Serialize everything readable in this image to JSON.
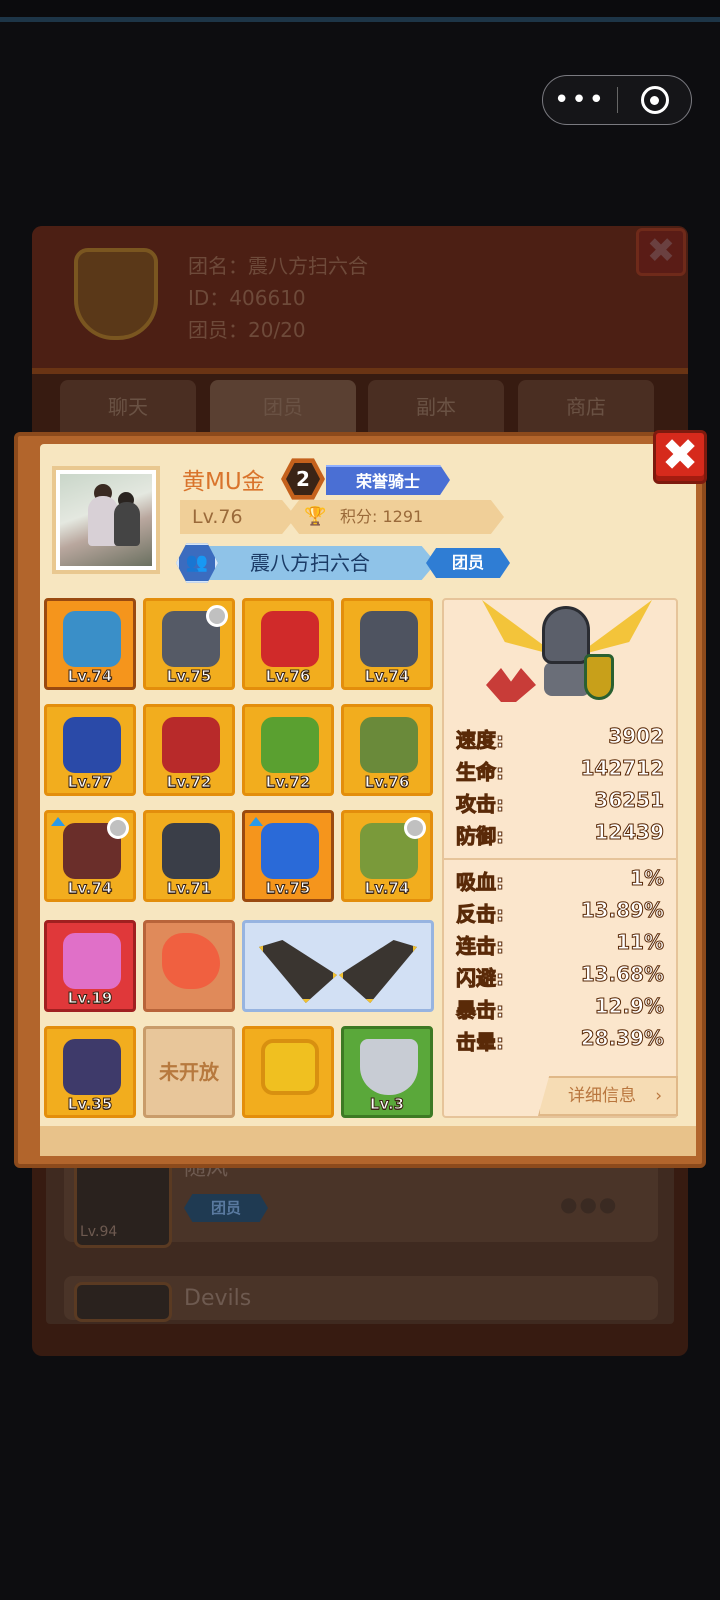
{
  "capsule": {
    "more_icon": "more-dots-icon",
    "target_icon": "target-icon"
  },
  "background": {
    "guild_name_line": "团名：震八方扫六合",
    "guild_id_line": "ID：406610",
    "members_line": "团员：20/20",
    "tabs": [
      "聊天",
      "团员",
      "副本",
      "商店"
    ],
    "member_rows": [
      {
        "name": "随风",
        "role": "团员",
        "level": "Lv.94"
      },
      {
        "name": "Devils"
      }
    ]
  },
  "player": {
    "name": "黄MU金",
    "rank_number": "2",
    "title": "荣誉骑士",
    "level": "Lv.76",
    "score_label": "积分: 1291",
    "guild_name": "震八方扫六合",
    "role": "团员"
  },
  "equipment": [
    {
      "level": "Lv.74",
      "icon": "helmet-icon",
      "style": "orange",
      "swirl": false,
      "up": false,
      "art": "#3a8fc8"
    },
    {
      "level": "Lv.75",
      "icon": "dark-helm-icon",
      "style": "gold",
      "swirl": true,
      "up": false,
      "art": "#555a66"
    },
    {
      "level": "Lv.76",
      "icon": "red-scarf-icon",
      "style": "gold",
      "swirl": false,
      "up": false,
      "art": "#d02a2a"
    },
    {
      "level": "Lv.74",
      "icon": "gauntlet-icon",
      "style": "gold",
      "swirl": false,
      "up": false,
      "art": "#4e5360"
    },
    {
      "level": "Lv.77",
      "icon": "blue-armor-icon",
      "style": "gold",
      "swirl": false,
      "up": false,
      "art": "#2a4aa8"
    },
    {
      "level": "Lv.72",
      "icon": "red-glove-icon",
      "style": "gold",
      "swirl": false,
      "up": false,
      "art": "#b82a2a"
    },
    {
      "level": "Lv.72",
      "icon": "green-belt-icon",
      "style": "gold",
      "swirl": false,
      "up": false,
      "art": "#5aa030"
    },
    {
      "level": "Lv.76",
      "icon": "green-vest-icon",
      "style": "gold",
      "swirl": false,
      "up": false,
      "art": "#6a8a3a"
    },
    {
      "level": "Lv.74",
      "icon": "spiked-mace-icon",
      "style": "gold",
      "swirl": true,
      "up": true,
      "art": "#6a2e2a"
    },
    {
      "level": "Lv.71",
      "icon": "dark-shield-icon",
      "style": "gold",
      "swirl": false,
      "up": false,
      "art": "#3a3e48"
    },
    {
      "level": "Lv.75",
      "icon": "blue-boots-icon",
      "style": "orange",
      "swirl": false,
      "up": true,
      "art": "#2a6ad8"
    },
    {
      "level": "Lv.74",
      "icon": "green-bracer-icon",
      "style": "gold",
      "swirl": true,
      "up": false,
      "art": "#7a9a3a"
    }
  ],
  "extras": {
    "pet1": {
      "level": "Lv.19",
      "icon": "dragon-pet-icon"
    },
    "fish": {
      "icon": "fish-icon"
    },
    "wings": {
      "icon": "wings-icon"
    },
    "pet2": {
      "level": "Lv.35",
      "icon": "demon-pet-icon"
    },
    "locked": {
      "label": "未开放"
    },
    "gem": {
      "icon": "gem-medal-icon"
    },
    "badge": {
      "level": "Lv.3",
      "icon": "shield-badge-icon"
    }
  },
  "stats_primary": [
    {
      "label": "速度:",
      "value": "3902"
    },
    {
      "label": "生命:",
      "value": "142712"
    },
    {
      "label": "攻击:",
      "value": "36251"
    },
    {
      "label": "防御:",
      "value": "12439"
    }
  ],
  "stats_secondary": [
    {
      "label": "吸血:",
      "value": "1%"
    },
    {
      "label": "反击:",
      "value": "13.89%"
    },
    {
      "label": "连击:",
      "value": "11%"
    },
    {
      "label": "闪避:",
      "value": "13.68%"
    },
    {
      "label": "暴击:",
      "value": "12.9%"
    },
    {
      "label": "击晕:",
      "value": "28.39%"
    }
  ],
  "detail_button": "详细信息",
  "close_symbol": "✖"
}
